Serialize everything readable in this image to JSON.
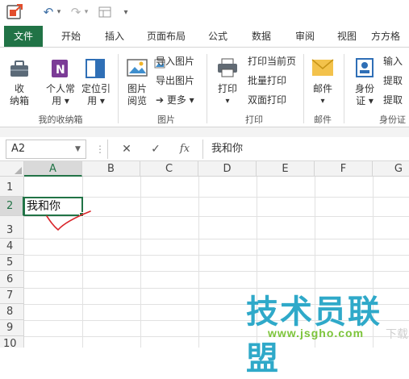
{
  "quick_access": {
    "undo_glyph": "↶",
    "redo_glyph": "↷",
    "customize_glyph": "▾"
  },
  "tabs": [
    {
      "label": "文件",
      "name": "tab-file"
    },
    {
      "label": "开始",
      "name": "tab-home"
    },
    {
      "label": "插入",
      "name": "tab-insert"
    },
    {
      "label": "页面布局",
      "name": "tab-page-layout"
    },
    {
      "label": "公式",
      "name": "tab-formulas"
    },
    {
      "label": "数据",
      "name": "tab-data"
    },
    {
      "label": "审阅",
      "name": "tab-review"
    },
    {
      "label": "视图",
      "name": "tab-view"
    },
    {
      "label": "方方格",
      "name": "tab-addin"
    }
  ],
  "ribbon": {
    "group1": {
      "btn_collect_l1": "收",
      "btn_collect_l2": "纳箱",
      "btn_personal_l1": "个人常",
      "btn_personal_l2": "用 ▾",
      "btn_locate_l1": "定位引",
      "btn_locate_l2": "用 ▾",
      "label": "我的收纳箱"
    },
    "group2": {
      "btn_browse_l1": "图片",
      "btn_browse_l2": "阅览",
      "import_images": "导入图片",
      "export_images": "导出图片",
      "more": "➔ 更多 ▾",
      "label": "图片"
    },
    "group3": {
      "btn_print_l1": "打印",
      "btn_print_l2": "▾",
      "print_current": "打印当前页",
      "batch_print": "批量打印",
      "duplex_print": "双面打印",
      "label": "打印"
    },
    "group4": {
      "btn_mail_l1": "邮件",
      "btn_mail_l2": "▾",
      "label": "邮件"
    },
    "group5": {
      "btn_id_l1": "身份",
      "btn_id_l2": "证 ▾",
      "input": "输入",
      "extract1": "提取",
      "extract2": "提取",
      "label": "身份证"
    }
  },
  "formula_bar": {
    "name_box": "A2",
    "cancel": "✕",
    "confirm": "✓",
    "fx": "fx",
    "content": "我和你"
  },
  "grid": {
    "columns": [
      "A",
      "B",
      "C",
      "D",
      "E",
      "F",
      "G"
    ],
    "rows": [
      "1",
      "2",
      "3",
      "4",
      "5",
      "6",
      "7",
      "8",
      "9",
      "10"
    ],
    "active_cell_value": "我和你"
  },
  "watermark": {
    "main": "技术员联盟",
    "url": "www.jsgho.com",
    "side": "下载"
  },
  "colors": {
    "excel_green": "#217346",
    "annotation_red": "#d9262b",
    "watermark_blue": "#2fa9c9",
    "watermark_green": "#7cc43a"
  }
}
